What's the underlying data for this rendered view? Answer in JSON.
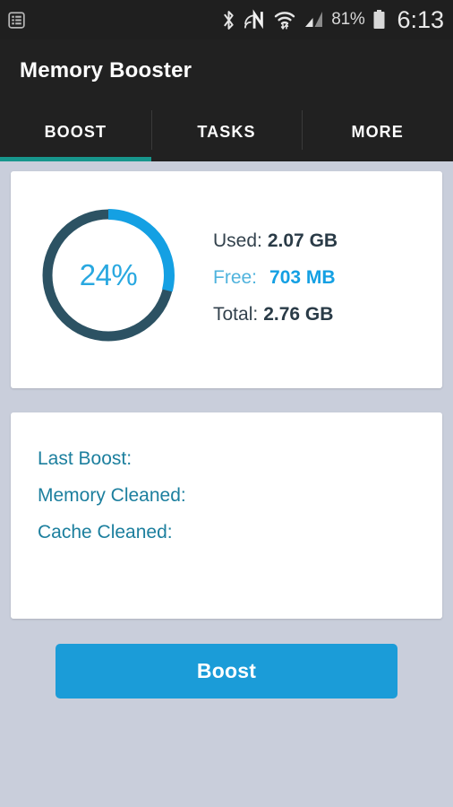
{
  "status_bar": {
    "left_icon": "list-notification-icon",
    "icons": [
      "bluetooth-icon",
      "nfc-icon",
      "wifi-icon",
      "cellular-signal-icon"
    ],
    "battery_percent": "81%",
    "battery_icon": "battery-icon",
    "time": "6:13"
  },
  "app_bar": {
    "title": "Memory Booster"
  },
  "tabs": {
    "items": [
      {
        "label": "BOOST",
        "active": true
      },
      {
        "label": "TASKS",
        "active": false
      },
      {
        "label": "MORE",
        "active": false
      }
    ],
    "indicator_color": "#17968c"
  },
  "memory_card": {
    "gauge": {
      "percent_label": "24%",
      "percent_value": 24,
      "arc_fraction": 0.29,
      "track_color": "#2c5263",
      "arc_color": "#14a0e3",
      "label_color": "#29a8e0"
    },
    "stats": [
      {
        "key": "Used:",
        "value": "2.07 GB"
      },
      {
        "key": "Free:",
        "value": "703 MB"
      },
      {
        "key": "Total:",
        "value": "2.76 GB"
      }
    ]
  },
  "history_card": {
    "rows": [
      {
        "label": "Last Boost:",
        "value": ""
      },
      {
        "label": "Memory Cleaned:",
        "value": ""
      },
      {
        "label": "Cache Cleaned:",
        "value": ""
      }
    ]
  },
  "actions": {
    "boost_label": "Boost",
    "boost_color": "#1b9cd8"
  }
}
